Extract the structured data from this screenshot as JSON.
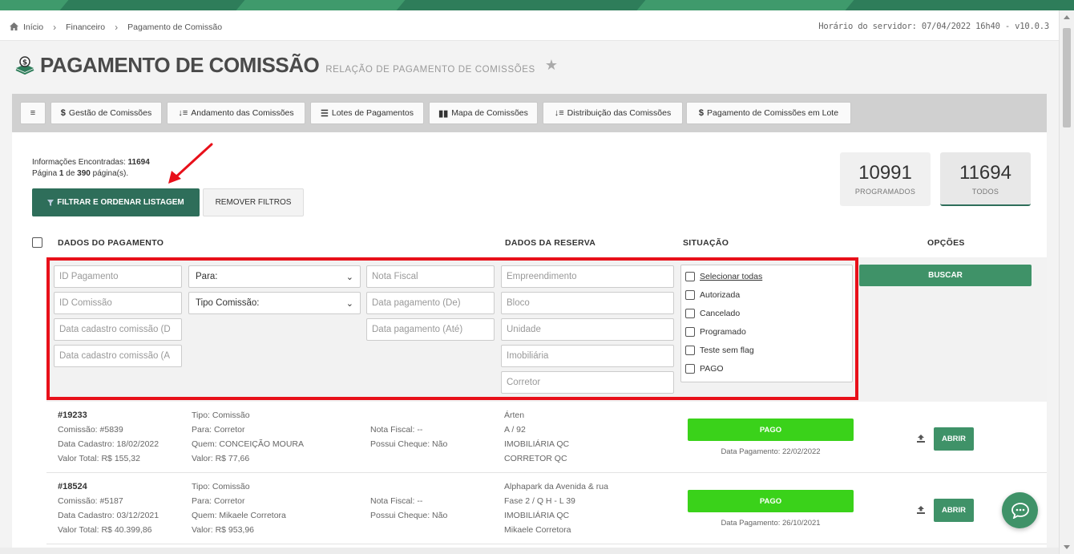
{
  "breadcrumb": {
    "home": "Início",
    "level1": "Financeiro",
    "level2": "Pagamento de Comissão"
  },
  "server_time": "Horário do servidor: 07/04/2022 16h40 - v10.0.3",
  "page": {
    "title": "PAGAMENTO DE COMISSÃO",
    "subtitle": "RELAÇÃO DE PAGAMENTO DE COMISSÕES"
  },
  "toolbar": {
    "menu_label": "≡",
    "items": [
      {
        "icon": "$",
        "label": "Gestão de Comissões"
      },
      {
        "icon": "↓≡",
        "label": "Andamento das Comissões"
      },
      {
        "icon": "☰",
        "label": "Lotes de Pagamentos"
      },
      {
        "icon": "▮▮",
        "label": "Mapa de Comissões"
      },
      {
        "icon": "↓≡",
        "label": "Distribuição das Comissões"
      },
      {
        "icon": "$",
        "label": "Pagamento de Comissões em Lote"
      }
    ]
  },
  "info": {
    "found_label": "Informações Encontradas:",
    "found_count": "11694",
    "page_prefix": "Página",
    "page_num": "1",
    "page_of": "de",
    "page_total": "390",
    "page_suffix": "página(s)."
  },
  "actions": {
    "filter_label": "FILTRAR E ORDENAR LISTAGEM",
    "remove_label": "REMOVER FILTROS"
  },
  "stats": [
    {
      "value": "10991",
      "label": "PROGRAMADOS"
    },
    {
      "value": "11694",
      "label": "TODOS"
    }
  ],
  "table_headers": {
    "payment": "DADOS DO PAGAMENTO",
    "reservation": "DADOS DA RESERVA",
    "status": "SITUAÇÃO",
    "options": "OPÇÕES"
  },
  "filters": {
    "id_pagamento": "ID Pagamento",
    "id_comissao": "ID Comissão",
    "data_cad_de": "Data cadastro comissão (D",
    "data_cad_ate": "Data cadastro comissão (A",
    "para": "Para:",
    "tipo_comissao": "Tipo Comissão:",
    "nota_fiscal": "Nota Fiscal",
    "data_pag_de": "Data pagamento (De)",
    "data_pag_ate": "Data pagamento (Até)",
    "empreendimento": "Empreendimento",
    "bloco": "Bloco",
    "unidade": "Unidade",
    "imobiliaria": "Imobiliária",
    "corretor": "Corretor",
    "situacao": [
      "Selecionar todas",
      "Autorizada",
      "Cancelado",
      "Programado",
      "Teste sem flag",
      "PAGO"
    ],
    "search_label": "BUSCAR"
  },
  "rows": [
    {
      "id": "#19233",
      "comissao": "Comissão: #5839",
      "data_cadastro": "Data Cadastro: 18/02/2022",
      "valor_total": "Valor Total: R$ 155,32",
      "tipo": "Tipo: Comissão",
      "para": "Para: Corretor",
      "quem": "Quem: CONCEIÇÃO MOURA",
      "valor": "Valor: R$ 77,66",
      "nota_fiscal": "Nota Fiscal: --",
      "cheque": "Possui Cheque: Não",
      "empreendimento": "Árten",
      "unidade": "A / 92",
      "imobiliaria": "IMOBILIÁRIA QC",
      "corretor": "CORRETOR QC",
      "status": "PAGO",
      "data_pagamento": "Data Pagamento: 22/02/2022",
      "open_label": "ABRIR"
    },
    {
      "id": "#18524",
      "comissao": "Comissão: #5187",
      "data_cadastro": "Data Cadastro: 03/12/2021",
      "valor_total": "Valor Total: R$ 40.399,86",
      "tipo": "Tipo: Comissão",
      "para": "Para: Corretor",
      "quem": "Quem: Mikaele Corretora",
      "valor": "Valor: R$ 953,96",
      "nota_fiscal": "Nota Fiscal: --",
      "cheque": "Possui Cheque: Não",
      "empreendimento": "Alphapark da Avenida & rua",
      "unidade": "Fase 2 / Q H - L 39",
      "imobiliaria": "IMOBILIÁRIA QC",
      "corretor": "Mikaele Corretora",
      "status": "PAGO",
      "data_pagamento": "Data Pagamento: 26/10/2021",
      "open_label": "ABRIR"
    }
  ],
  "colors": {
    "brand_green": "#2e6e5a",
    "button_green": "#3f9268",
    "status_pago": "#3ad21a",
    "highlight_red": "#e8101a"
  }
}
